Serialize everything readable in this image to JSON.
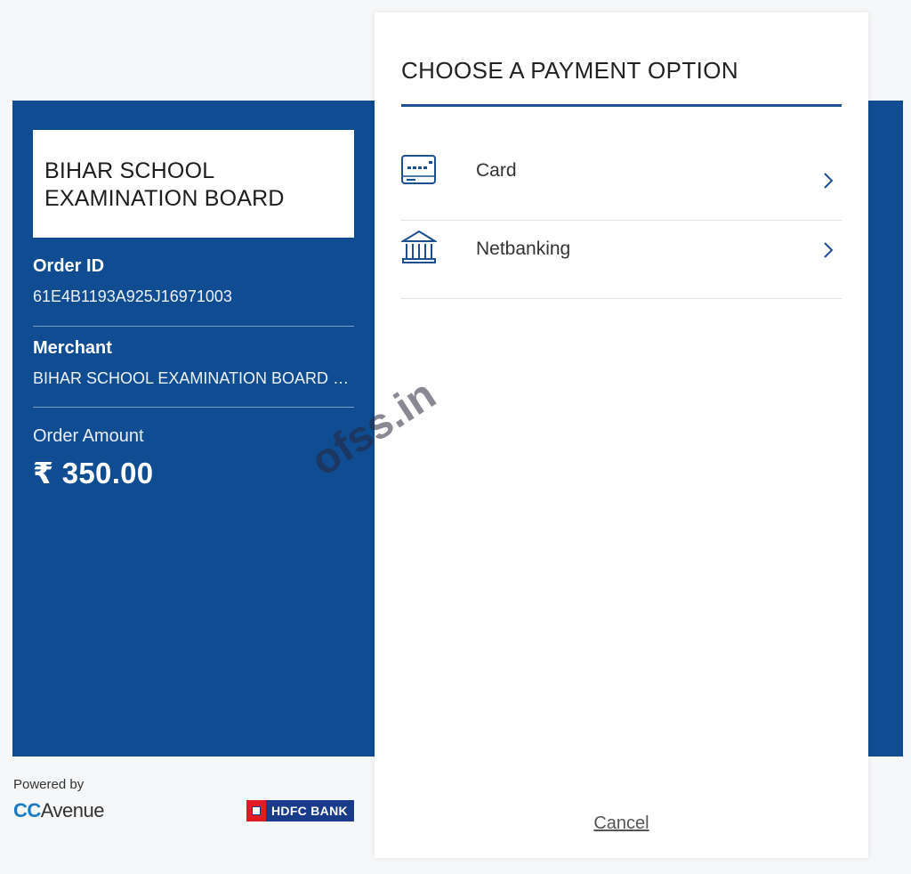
{
  "merchant_box": {
    "name": "BIHAR SCHOOL EXAMINATION BOARD"
  },
  "order": {
    "id_label": "Order ID",
    "id_value": "61E4B1193A925J16971003",
    "merchant_label": "Merchant",
    "merchant_value": "BIHAR SCHOOL EXAMINATION BOARD O...",
    "amount_label": "Order Amount",
    "amount_value": "₹ 350.00"
  },
  "panel": {
    "title": "CHOOSE A PAYMENT OPTION",
    "options": [
      {
        "label": "Card",
        "icon": "card-icon"
      },
      {
        "label": "Netbanking",
        "icon": "bank-icon"
      }
    ],
    "cancel_label": "Cancel"
  },
  "footer": {
    "powered_by": "Powered by",
    "ccavenue_cc": "CC",
    "ccavenue_rest": "Avenue",
    "hdfc_label": "HDFC BANK"
  },
  "watermark": "ofss.in",
  "colors": {
    "brand_blue": "#0f4c91",
    "rule_blue": "#1c4f8f",
    "hdfc_red": "#e11b22"
  }
}
